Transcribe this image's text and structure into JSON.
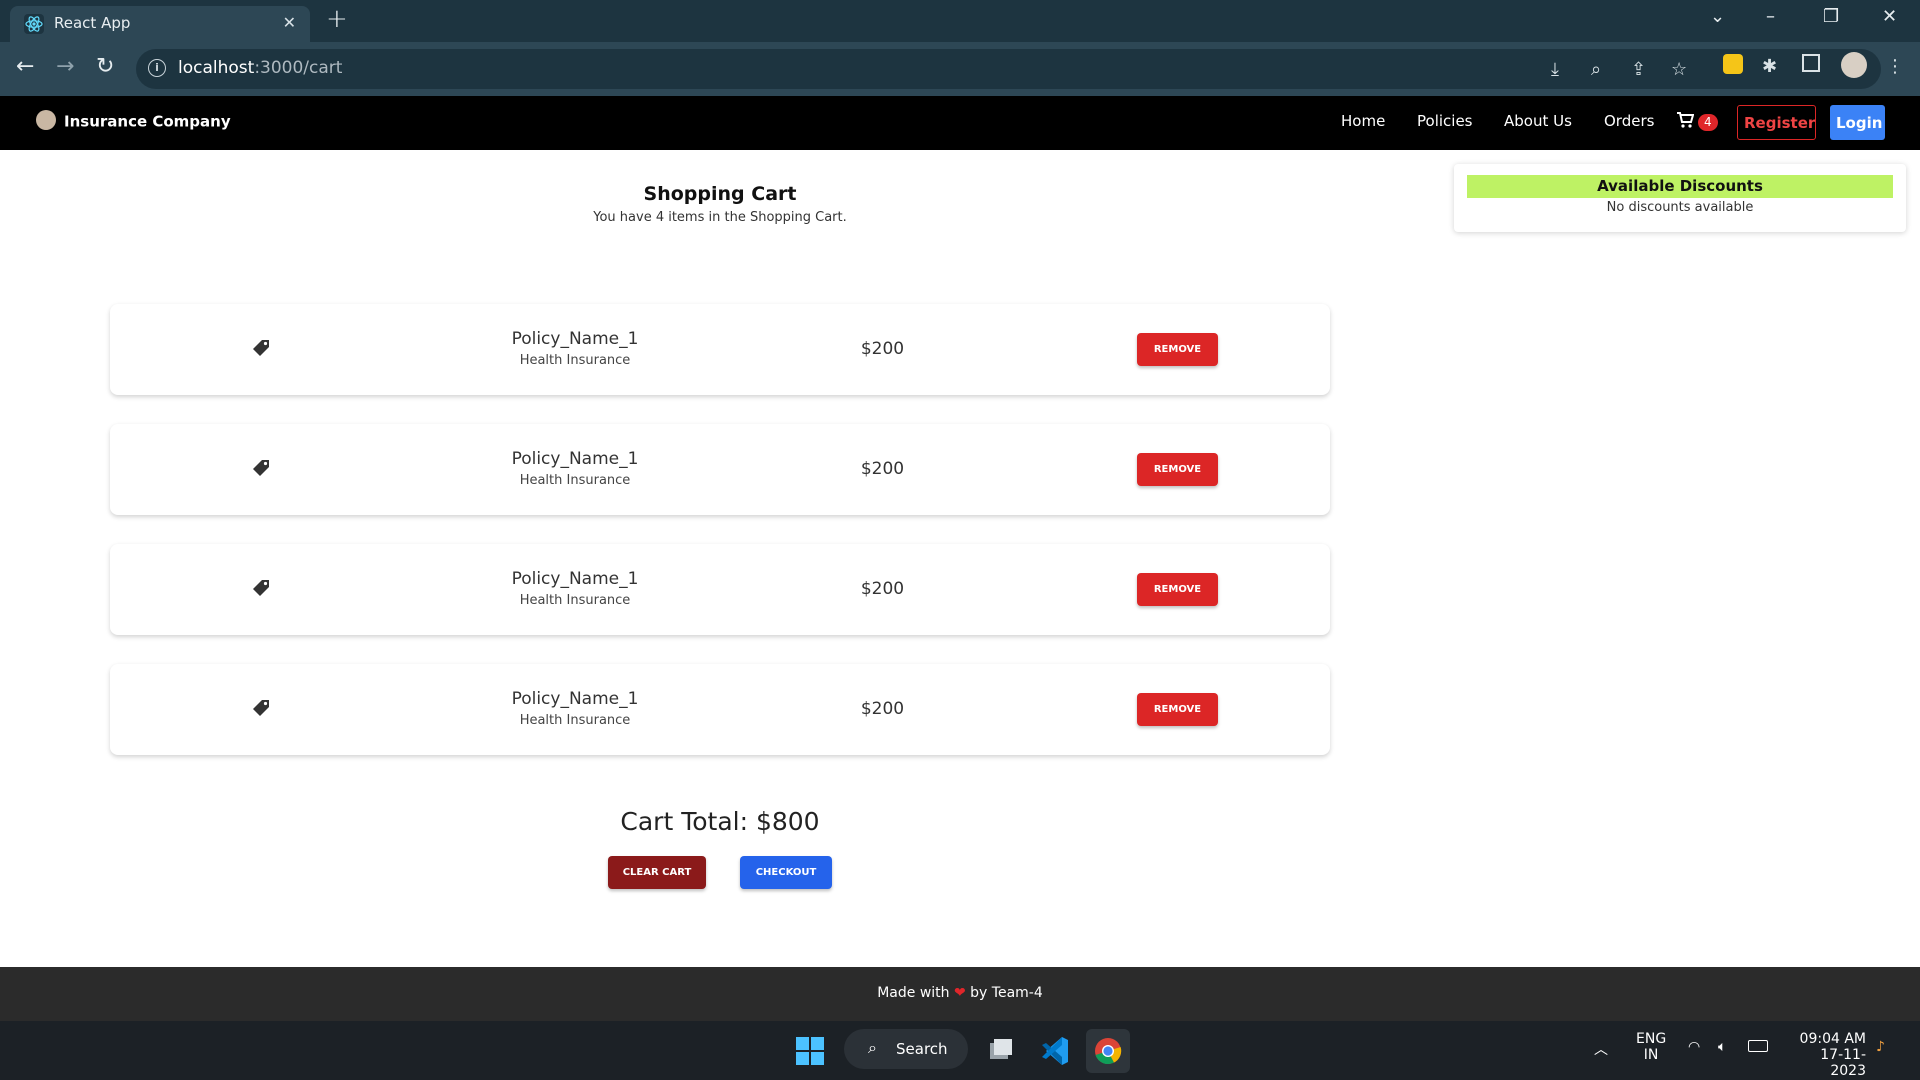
{
  "browser": {
    "tab_title": "React App",
    "url_host": "localhost",
    "url_path": ":3000/cart"
  },
  "navbar": {
    "brand": "Insurance Company",
    "links": [
      "Home",
      "Policies",
      "About Us",
      "Orders"
    ],
    "cart_count": "4",
    "register": "Register",
    "login": "Login"
  },
  "cart": {
    "title": "Shopping Cart",
    "subtitle": "You have 4 items in the Shopping Cart.",
    "items": [
      {
        "name": "Policy_Name_1",
        "type": "Health Insurance",
        "price": "$200",
        "action": "REMOVE"
      },
      {
        "name": "Policy_Name_1",
        "type": "Health Insurance",
        "price": "$200",
        "action": "REMOVE"
      },
      {
        "name": "Policy_Name_1",
        "type": "Health Insurance",
        "price": "$200",
        "action": "REMOVE"
      },
      {
        "name": "Policy_Name_1",
        "type": "Health Insurance",
        "price": "$200",
        "action": "REMOVE"
      }
    ],
    "total": "Cart Total: $800",
    "clear_label": "CLEAR CART",
    "checkout_label": "CHECKOUT"
  },
  "discounts": {
    "title": "Available Discounts",
    "message": "No discounts available"
  },
  "footer": {
    "made_with": "Made with",
    "by": "by Team-4"
  },
  "taskbar": {
    "search": "Search",
    "lang_top": "ENG",
    "lang_bottom": "IN",
    "time": "09:04 AM",
    "date": "17-11-2023"
  },
  "colors": {
    "remove": "#dc2626",
    "clear": "#8b1a1a",
    "checkout": "#2563eb",
    "discount_header": "#bef264"
  }
}
